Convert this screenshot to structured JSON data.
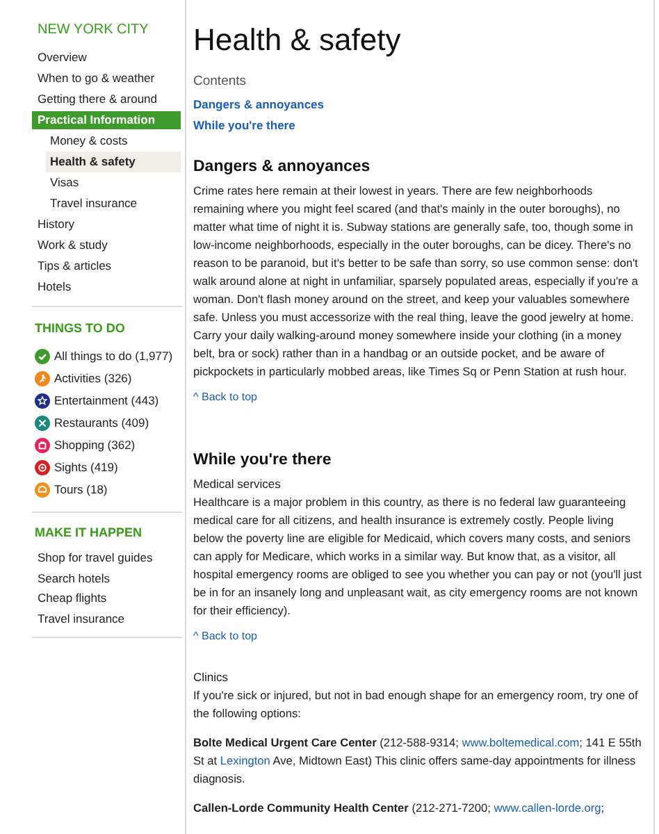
{
  "sidebar": {
    "city": "NEW YORK CITY",
    "nav": [
      {
        "label": "Overview",
        "selected": false
      },
      {
        "label": "When to go & weather",
        "selected": false
      },
      {
        "label": "Getting there & around",
        "selected": false
      },
      {
        "label": "Practical Information",
        "selected": true,
        "children": [
          {
            "label": "Money & costs",
            "selected": false
          },
          {
            "label": "Health & safety",
            "selected": true
          },
          {
            "label": "Visas",
            "selected": false
          },
          {
            "label": "Travel insurance",
            "selected": false
          }
        ]
      },
      {
        "label": "History",
        "selected": false
      },
      {
        "label": "Work & study",
        "selected": false
      },
      {
        "label": "Tips & articles",
        "selected": false
      },
      {
        "label": "Hotels",
        "selected": false
      }
    ],
    "things_to_do": {
      "heading": "THINGS TO DO",
      "items": [
        {
          "label": "All things to do (1,977)",
          "kind": "check",
          "color": "#3d9a2b"
        },
        {
          "label": "Activities (326)",
          "kind": "runner",
          "color": "#ee8a1d"
        },
        {
          "label": "Entertainment (443)",
          "kind": "star",
          "color": "#1d2f86"
        },
        {
          "label": "Restaurants (409)",
          "kind": "cutlery",
          "color": "#1a8a7e"
        },
        {
          "label": "Shopping (362)",
          "kind": "bag",
          "color": "#e2265c"
        },
        {
          "label": "Sights (419)",
          "kind": "eye",
          "color": "#d61f20"
        },
        {
          "label": "Tours (18)",
          "kind": "tour",
          "color": "#f0921e"
        }
      ]
    },
    "make_it_happen": {
      "heading": "MAKE IT HAPPEN",
      "items": [
        "Shop for travel guides",
        "Search hotels",
        "Cheap flights",
        "Travel insurance"
      ]
    }
  },
  "content": {
    "title": "Health & safety",
    "contents_label": "Contents",
    "contents_links": [
      "Dangers & annoyances",
      "While you're there"
    ],
    "sections": [
      {
        "heading": "Dangers & annoyances",
        "blocks": [
          {
            "kind": "paragraph",
            "parts": [
              {
                "kind": "text",
                "text": "Crime rates here remain at their lowest in years. There are few neighborhoods remaining where you might feel scared (and that's mainly in the outer boroughs), no matter what time of night it is. Subway stations are generally safe, too, though some in low-income neighborhoods, especially in the outer boroughs, can be dicey. There's no reason to be paranoid, but it's better to be safe than sorry, so use common sense: don't walk around alone at night in unfamiliar, sparsely populated areas, especially if you're a woman. Don't flash money around on the street, and keep your valuables somewhere safe. Unless you must accessorize with the real thing, leave the good jewelry at home. Carry your daily walking-around money somewhere inside your clothing (in a money belt, bra or sock) rather than in a handbag or an outside pocket, and be aware of pickpockets in particularly mobbed areas, like Times Sq or Penn Station at rush hour."
              }
            ]
          },
          {
            "kind": "back_to_top",
            "text": "^ Back to top"
          }
        ]
      },
      {
        "heading": "While you're there",
        "blocks": [
          {
            "kind": "subheading",
            "text": "Medical services"
          },
          {
            "kind": "paragraph",
            "parts": [
              {
                "kind": "text",
                "text": "Healthcare is a major problem in this country, as there is no federal law guaranteeing medical care for all citizens, and health insurance is extremely costly. People living below the poverty line are eligible for Medicaid, which covers many costs, and seniors can apply for Medicare, which works in a similar way. But know that, as a visitor, all hospital emergency rooms are obliged to see you whether you can pay or not (you'll just be in for an insanely long and unpleasant wait, as city emergency rooms are not known for their efficiency)."
              }
            ]
          },
          {
            "kind": "back_to_top",
            "text": "^ Back to top"
          },
          {
            "kind": "subheading",
            "text": "Clinics"
          },
          {
            "kind": "paragraph",
            "parts": [
              {
                "kind": "text",
                "text": "If you're sick or injured, but not in bad enough shape for an emergency room, try one of the following options:"
              }
            ]
          },
          {
            "kind": "listing",
            "parts": [
              {
                "kind": "bold",
                "text": "Bolte Medical Urgent Care Center"
              },
              {
                "kind": "text",
                "text": " (212-588-9314; "
              },
              {
                "kind": "link",
                "text": "www.boltemedical.com"
              },
              {
                "kind": "text",
                "text": "; 141 E 55th St at "
              },
              {
                "kind": "link",
                "text": "Lexington"
              },
              {
                "kind": "text",
                "text": " Ave, Midtown East) This clinic offers same-day appointments for illness diagnosis."
              }
            ]
          },
          {
            "kind": "listing",
            "parts": [
              {
                "kind": "bold",
                "text": "Callen-Lorde Community Health Center"
              },
              {
                "kind": "text",
                "text": " (212-271-7200; "
              },
              {
                "kind": "link",
                "text": "www.callen-lorde.org"
              },
              {
                "kind": "text",
                "text": ";"
              }
            ]
          }
        ]
      }
    ]
  }
}
